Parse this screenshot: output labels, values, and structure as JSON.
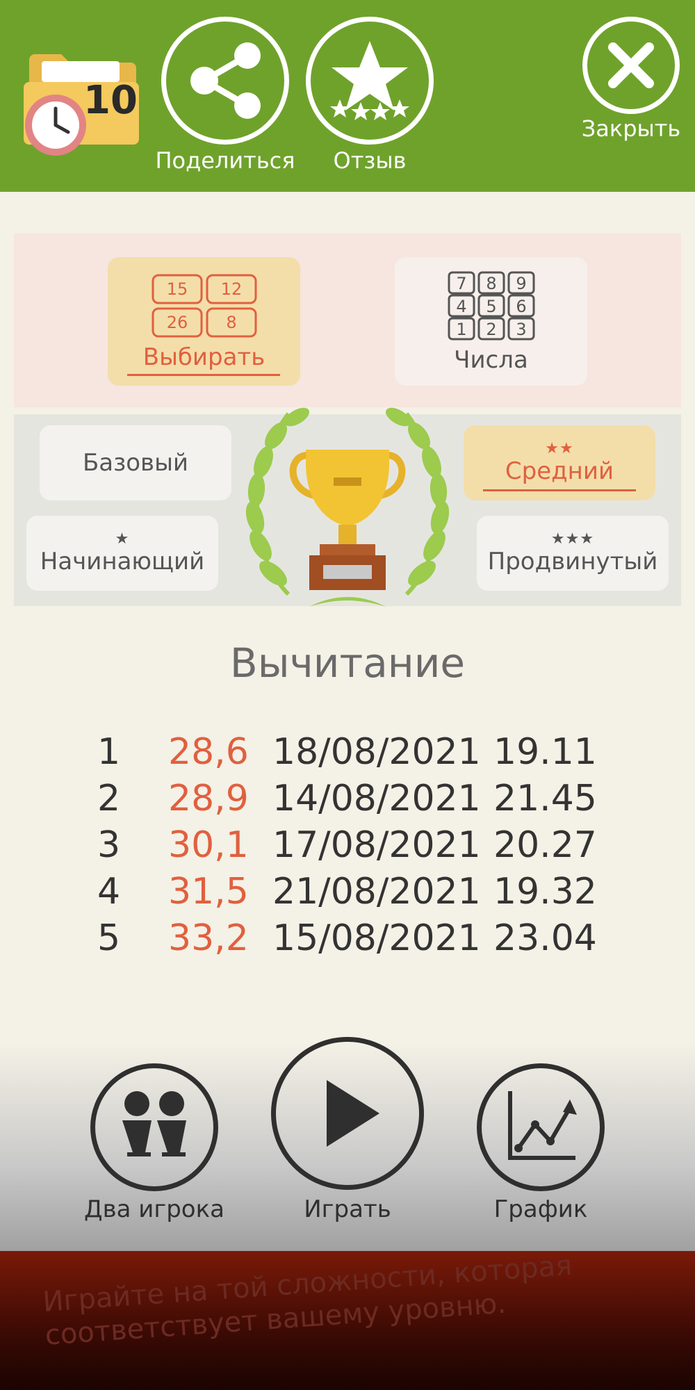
{
  "header": {
    "badge_number": "10",
    "share_label": "Поделиться",
    "review_label": "Отзыв",
    "close_label": "Закрыть"
  },
  "modes": [
    {
      "label": "Выбирать",
      "selected": true,
      "tiles": [
        "15",
        "12",
        "26",
        "8"
      ]
    },
    {
      "label": "Числа",
      "selected": false,
      "keypad": [
        "7",
        "8",
        "9",
        "4",
        "5",
        "6",
        "1",
        "2",
        "3"
      ]
    }
  ],
  "levels": {
    "basic": {
      "label": "Базовый",
      "stars": ""
    },
    "medium": {
      "label": "Средний",
      "stars": "★★",
      "selected": true
    },
    "beginner": {
      "label": "Начинающий",
      "stars": "★"
    },
    "advanced": {
      "label": "Продвинутый",
      "stars": "★★★"
    }
  },
  "operation_title": "Вычитание",
  "scores": [
    {
      "rank": "1",
      "time": "28,6",
      "date": "18/08/2021",
      "clock": "19.11"
    },
    {
      "rank": "2",
      "time": "28,9",
      "date": "14/08/2021",
      "clock": "21.45"
    },
    {
      "rank": "3",
      "time": "30,1",
      "date": "17/08/2021",
      "clock": "20.27"
    },
    {
      "rank": "4",
      "time": "31,5",
      "date": "21/08/2021",
      "clock": "19.32"
    },
    {
      "rank": "5",
      "time": "33,2",
      "date": "15/08/2021",
      "clock": "23.04"
    }
  ],
  "bottom": {
    "two_players_label": "Два игрока",
    "play_label": "Играть",
    "chart_label": "График"
  },
  "banner_text": "Играйте на той сложности, которая соответствует вашему уровню.",
  "colors": {
    "header_green": "#6fa22b",
    "accent_red": "#e0603f",
    "selected_card": "#f3deaa"
  }
}
